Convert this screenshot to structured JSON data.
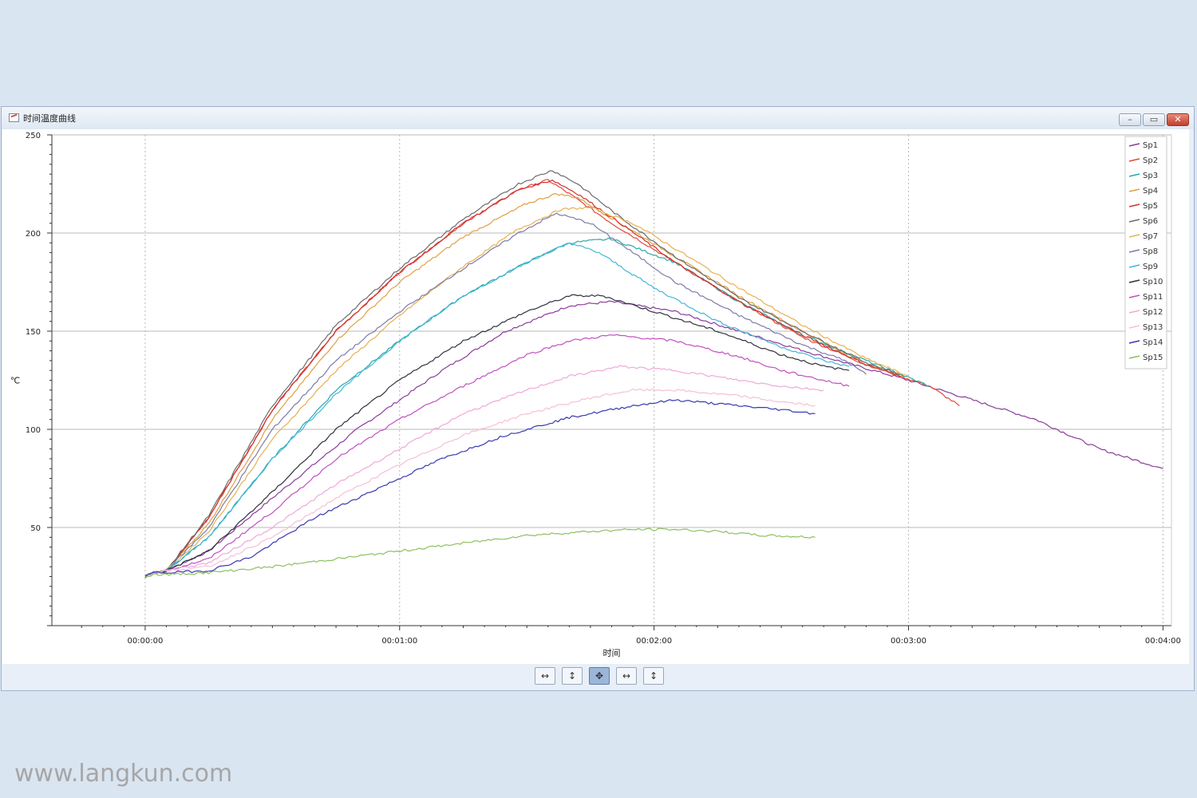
{
  "window": {
    "title": "时间温度曲线",
    "controls": {
      "minimize": "–",
      "maximize": "▭",
      "close": "✕"
    }
  },
  "toolbar": {
    "buttons": [
      {
        "icon": "pan-horizontal-icon",
        "glyph": "↔",
        "active": false
      },
      {
        "icon": "pan-vertical-icon",
        "glyph": "↕",
        "active": false
      },
      {
        "icon": "pan-both-icon",
        "glyph": "✥",
        "active": true
      },
      {
        "icon": "zoom-horizontal-icon",
        "glyph": "↔",
        "active": false
      },
      {
        "icon": "zoom-vertical-icon",
        "glyph": "↕",
        "active": false
      }
    ]
  },
  "chart_data": {
    "type": "line",
    "title": "",
    "xlabel": "时间",
    "ylabel": "℃",
    "xlim": [
      -22,
      242
    ],
    "ylim": [
      0,
      250
    ],
    "x_ticks": [
      0,
      60,
      120,
      180,
      240
    ],
    "x_tick_labels": [
      "00:00:00",
      "00:01:00",
      "00:02:00",
      "00:03:00",
      "00:04:00"
    ],
    "y_ticks": [
      50,
      100,
      150,
      200,
      250
    ],
    "y_tick_labels": [
      "50",
      "100",
      "150",
      "200",
      "250"
    ],
    "grid": true,
    "legend_position": "top-right",
    "series": [
      {
        "name": "Sp1",
        "color": "#8a3c9a",
        "points": [
          [
            0,
            25
          ],
          [
            2,
            27
          ],
          [
            5,
            28
          ],
          [
            15,
            38
          ],
          [
            30,
            65
          ],
          [
            50,
            100
          ],
          [
            70,
            130
          ],
          [
            85,
            150
          ],
          [
            100,
            163
          ],
          [
            110,
            165
          ],
          [
            125,
            160
          ],
          [
            140,
            150
          ],
          [
            160,
            137
          ],
          [
            180,
            125
          ],
          [
            210,
            105
          ],
          [
            225,
            90
          ],
          [
            240,
            80
          ]
        ]
      },
      {
        "name": "Sp2",
        "color": "#e04a3a",
        "points": [
          [
            0,
            25
          ],
          [
            2,
            27
          ],
          [
            5,
            28
          ],
          [
            15,
            55
          ],
          [
            30,
            110
          ],
          [
            45,
            150
          ],
          [
            60,
            180
          ],
          [
            75,
            205
          ],
          [
            88,
            222
          ],
          [
            95,
            227
          ],
          [
            100,
            220
          ],
          [
            110,
            205
          ],
          [
            125,
            185
          ],
          [
            140,
            165
          ],
          [
            155,
            147
          ],
          [
            170,
            133
          ],
          [
            185,
            122
          ],
          [
            192,
            112
          ]
        ]
      },
      {
        "name": "Sp3",
        "color": "#2aa8a8",
        "points": [
          [
            0,
            25
          ],
          [
            2,
            27
          ],
          [
            5,
            28
          ],
          [
            15,
            45
          ],
          [
            30,
            85
          ],
          [
            45,
            120
          ],
          [
            60,
            145
          ],
          [
            75,
            168
          ],
          [
            90,
            185
          ],
          [
            100,
            195
          ],
          [
            110,
            197
          ],
          [
            125,
            185
          ],
          [
            140,
            165
          ],
          [
            155,
            148
          ],
          [
            170,
            135
          ],
          [
            185,
            122
          ]
        ]
      },
      {
        "name": "Sp4",
        "color": "#e0a040",
        "points": [
          [
            0,
            25
          ],
          [
            2,
            27
          ],
          [
            5,
            28
          ],
          [
            15,
            52
          ],
          [
            30,
            105
          ],
          [
            45,
            145
          ],
          [
            60,
            175
          ],
          [
            75,
            198
          ],
          [
            90,
            215
          ],
          [
            97,
            220
          ],
          [
            102,
            218
          ],
          [
            112,
            205
          ],
          [
            125,
            188
          ],
          [
            140,
            168
          ],
          [
            155,
            150
          ],
          [
            170,
            133
          ],
          [
            178,
            128
          ]
        ]
      },
      {
        "name": "Sp5",
        "color": "#d23030",
        "points": [
          [
            0,
            25
          ],
          [
            2,
            27
          ],
          [
            5,
            28
          ],
          [
            15,
            55
          ],
          [
            30,
            110
          ],
          [
            45,
            150
          ],
          [
            60,
            180
          ],
          [
            75,
            205
          ],
          [
            88,
            222
          ],
          [
            96,
            227
          ],
          [
            102,
            220
          ],
          [
            112,
            205
          ],
          [
            125,
            185
          ],
          [
            140,
            165
          ],
          [
            155,
            148
          ],
          [
            170,
            133
          ],
          [
            178,
            127
          ]
        ]
      },
      {
        "name": "Sp6",
        "color": "#6b6b6b",
        "points": [
          [
            0,
            25
          ],
          [
            2,
            27
          ],
          [
            5,
            28
          ],
          [
            15,
            56
          ],
          [
            30,
            112
          ],
          [
            45,
            153
          ],
          [
            60,
            182
          ],
          [
            75,
            207
          ],
          [
            88,
            225
          ],
          [
            96,
            232
          ],
          [
            102,
            225
          ],
          [
            112,
            208
          ],
          [
            125,
            188
          ],
          [
            140,
            167
          ],
          [
            155,
            150
          ],
          [
            170,
            134
          ],
          [
            178,
            128
          ]
        ]
      },
      {
        "name": "Sp7",
        "color": "#e8b050",
        "points": [
          [
            0,
            25
          ],
          [
            2,
            27
          ],
          [
            5,
            28
          ],
          [
            15,
            48
          ],
          [
            30,
            95
          ],
          [
            45,
            130
          ],
          [
            60,
            158
          ],
          [
            75,
            183
          ],
          [
            88,
            202
          ],
          [
            98,
            212
          ],
          [
            105,
            213
          ],
          [
            115,
            205
          ],
          [
            125,
            192
          ],
          [
            140,
            172
          ],
          [
            155,
            153
          ],
          [
            170,
            136
          ],
          [
            180,
            127
          ]
        ]
      },
      {
        "name": "Sp8",
        "color": "#7c7ca8",
        "points": [
          [
            0,
            25
          ],
          [
            2,
            27
          ],
          [
            5,
            28
          ],
          [
            15,
            50
          ],
          [
            30,
            100
          ],
          [
            45,
            135
          ],
          [
            60,
            160
          ],
          [
            75,
            182
          ],
          [
            88,
            200
          ],
          [
            97,
            210
          ],
          [
            105,
            205
          ],
          [
            115,
            190
          ],
          [
            125,
            175
          ],
          [
            140,
            158
          ],
          [
            155,
            143
          ],
          [
            165,
            135
          ],
          [
            170,
            128
          ]
        ]
      },
      {
        "name": "Sp9",
        "color": "#40b8d8",
        "points": [
          [
            0,
            25
          ],
          [
            2,
            27
          ],
          [
            5,
            28
          ],
          [
            15,
            45
          ],
          [
            30,
            85
          ],
          [
            45,
            118
          ],
          [
            60,
            145
          ],
          [
            75,
            168
          ],
          [
            90,
            185
          ],
          [
            100,
            195
          ],
          [
            107,
            190
          ],
          [
            120,
            172
          ],
          [
            135,
            155
          ],
          [
            150,
            142
          ],
          [
            160,
            135
          ],
          [
            166,
            132
          ]
        ]
      },
      {
        "name": "Sp10",
        "color": "#303040",
        "points": [
          [
            0,
            25
          ],
          [
            2,
            27
          ],
          [
            5,
            28
          ],
          [
            15,
            38
          ],
          [
            30,
            68
          ],
          [
            45,
            100
          ],
          [
            60,
            125
          ],
          [
            75,
            145
          ],
          [
            90,
            160
          ],
          [
            100,
            168
          ],
          [
            108,
            168
          ],
          [
            120,
            160
          ],
          [
            135,
            150
          ],
          [
            150,
            138
          ],
          [
            160,
            132
          ],
          [
            166,
            130
          ]
        ]
      },
      {
        "name": "Sp11",
        "color": "#c050c0",
        "points": [
          [
            0,
            25
          ],
          [
            2,
            27
          ],
          [
            5,
            28
          ],
          [
            15,
            34
          ],
          [
            30,
            58
          ],
          [
            45,
            85
          ],
          [
            60,
            105
          ],
          [
            75,
            122
          ],
          [
            90,
            138
          ],
          [
            100,
            145
          ],
          [
            110,
            148
          ],
          [
            125,
            145
          ],
          [
            140,
            137
          ],
          [
            150,
            130
          ],
          [
            160,
            125
          ],
          [
            166,
            122
          ]
        ]
      },
      {
        "name": "Sp12",
        "color": "#f0a8d8",
        "points": [
          [
            0,
            25
          ],
          [
            2,
            27
          ],
          [
            5,
            28
          ],
          [
            15,
            32
          ],
          [
            30,
            50
          ],
          [
            45,
            72
          ],
          [
            60,
            90
          ],
          [
            75,
            108
          ],
          [
            90,
            120
          ],
          [
            100,
            127
          ],
          [
            112,
            132
          ],
          [
            125,
            130
          ],
          [
            140,
            125
          ],
          [
            150,
            122
          ],
          [
            160,
            120
          ]
        ]
      },
      {
        "name": "Sp13",
        "color": "#f5c0d8",
        "points": [
          [
            0,
            25
          ],
          [
            2,
            27
          ],
          [
            5,
            28
          ],
          [
            15,
            30
          ],
          [
            30,
            45
          ],
          [
            45,
            65
          ],
          [
            60,
            82
          ],
          [
            75,
            97
          ],
          [
            90,
            108
          ],
          [
            105,
            116
          ],
          [
            115,
            120
          ],
          [
            125,
            120
          ],
          [
            140,
            117
          ],
          [
            150,
            114
          ],
          [
            158,
            112
          ]
        ]
      },
      {
        "name": "Sp14",
        "color": "#3838b0",
        "points": [
          [
            0,
            25
          ],
          [
            2,
            27
          ],
          [
            5,
            27
          ],
          [
            15,
            28
          ],
          [
            25,
            35
          ],
          [
            40,
            55
          ],
          [
            55,
            70
          ],
          [
            70,
            85
          ],
          [
            85,
            97
          ],
          [
            100,
            106
          ],
          [
            115,
            112
          ],
          [
            125,
            115
          ],
          [
            140,
            112
          ],
          [
            150,
            110
          ],
          [
            158,
            108
          ]
        ]
      },
      {
        "name": "Sp15",
        "color": "#8cc060",
        "points": [
          [
            0,
            25
          ],
          [
            2,
            26
          ],
          [
            5,
            26
          ],
          [
            15,
            27
          ],
          [
            30,
            30
          ],
          [
            45,
            34
          ],
          [
            60,
            38
          ],
          [
            75,
            42
          ],
          [
            90,
            46
          ],
          [
            105,
            48
          ],
          [
            115,
            49
          ],
          [
            125,
            49
          ],
          [
            135,
            48
          ],
          [
            145,
            46
          ],
          [
            158,
            45
          ]
        ]
      }
    ]
  },
  "colors": {
    "window_bg": "#e8eff8",
    "page_bg": "#dae5f2",
    "grid": "#b8b8b8",
    "axis": "#333333"
  },
  "watermark": "www.langkun.com"
}
